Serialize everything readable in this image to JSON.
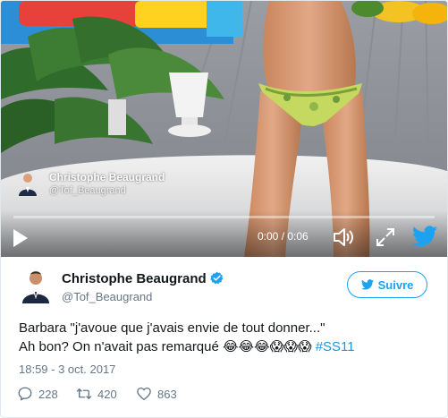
{
  "colors": {
    "brand": "#1da1f2",
    "link": "#1b95e0",
    "muted": "#657786"
  },
  "video": {
    "overlay_author_name": "Christophe Beaugrand",
    "overlay_author_handle": "@Tof_Beaugrand",
    "time": "0:00 / 0:06",
    "progress": 0.0,
    "icons": [
      "play-icon",
      "volume-icon",
      "fullscreen-icon",
      "twitter-bird-icon"
    ]
  },
  "tweet": {
    "author_name": "Christophe Beaugrand",
    "author_handle": "@Tof_Beaugrand",
    "verified": true,
    "follow_label": "Suivre",
    "text_line1": "Barbara \"j'avoue que j'avais envie de tout donner...\"",
    "text_line2_prefix": "Ah bon? On n'avait pas remarqué ",
    "emojis": "😂😂😂😱😱😱",
    "hashtag": "#SS11",
    "timestamp": "18:59 - 3 oct. 2017",
    "replies": "228",
    "retweets": "420",
    "likes": "863"
  }
}
